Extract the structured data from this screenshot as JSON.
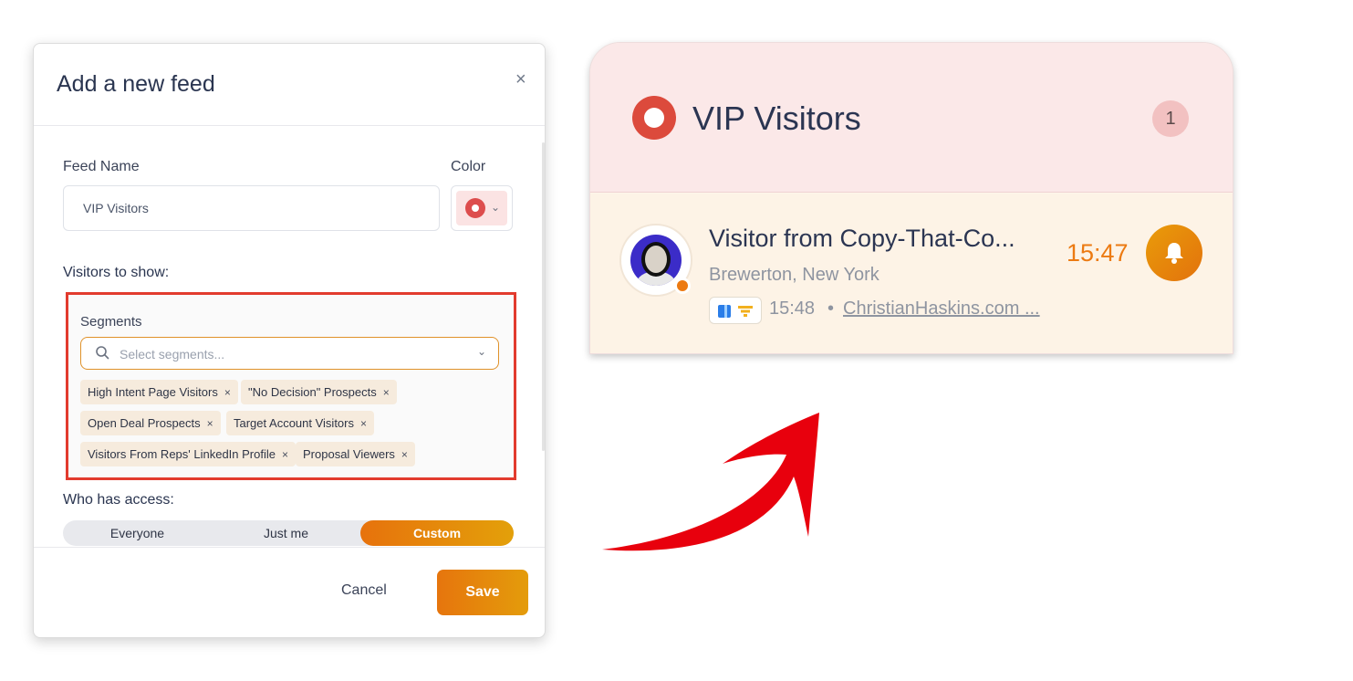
{
  "modal": {
    "title": "Add a new feed",
    "close_symbol": "×",
    "feed_name_label": "Feed Name",
    "feed_name_value": "VIP Visitors",
    "color_label": "Color",
    "color_value": "#dd4d4d",
    "visitors_label": "Visitors to show:",
    "segments_label": "Segments",
    "segments_placeholder": "Select segments...",
    "segments": [
      "High Intent Page Visitors",
      "\"No Decision\" Prospects",
      "Open Deal Prospects",
      "Target Account Visitors",
      "Visitors From Reps' LinkedIn Profile",
      "Proposal Viewers"
    ],
    "chip_remove_symbol": "×",
    "access_label": "Who has access:",
    "access_options": [
      "Everyone",
      "Just me",
      "Custom"
    ],
    "access_selected": "Custom",
    "cancel_label": "Cancel",
    "save_label": "Save"
  },
  "feed_preview": {
    "title": "VIP Visitors",
    "count": "1",
    "visitor": {
      "name": "Visitor from Copy-That-Co...",
      "location": "Brewerton, New York",
      "visit_time": "15:48",
      "separator": "•",
      "site": "ChristianHaskins.com ...",
      "time": "15:47"
    }
  },
  "colors": {
    "accent": "#e6750d",
    "feed_header_bg": "#fbe8e8",
    "highlight_border": "#e23b2e",
    "arrow": "#e8000d"
  }
}
